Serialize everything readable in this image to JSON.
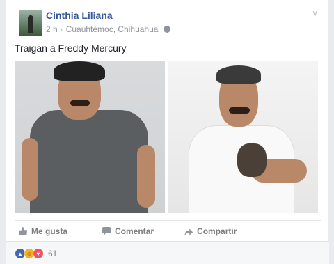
{
  "post": {
    "author": "Cinthia Liliana",
    "time": "2 h",
    "separator": "·",
    "location": "Cuauhtémoc, Chihuahua",
    "privacy_icon": "globe-icon",
    "options_icon": "chevron-down-icon",
    "text": "Traigan a Freddy Mercury"
  },
  "actions": {
    "like": "Me gusta",
    "comment": "Comentar",
    "share": "Compartir"
  },
  "reactions": {
    "icons": [
      "like-reaction-icon",
      "haha-reaction-icon",
      "love-reaction-icon"
    ],
    "count": "61"
  },
  "colors": {
    "author": "#365899",
    "meta": "#90949c",
    "like": "#4267b2",
    "haha": "#f7b125",
    "love": "#f25268"
  }
}
